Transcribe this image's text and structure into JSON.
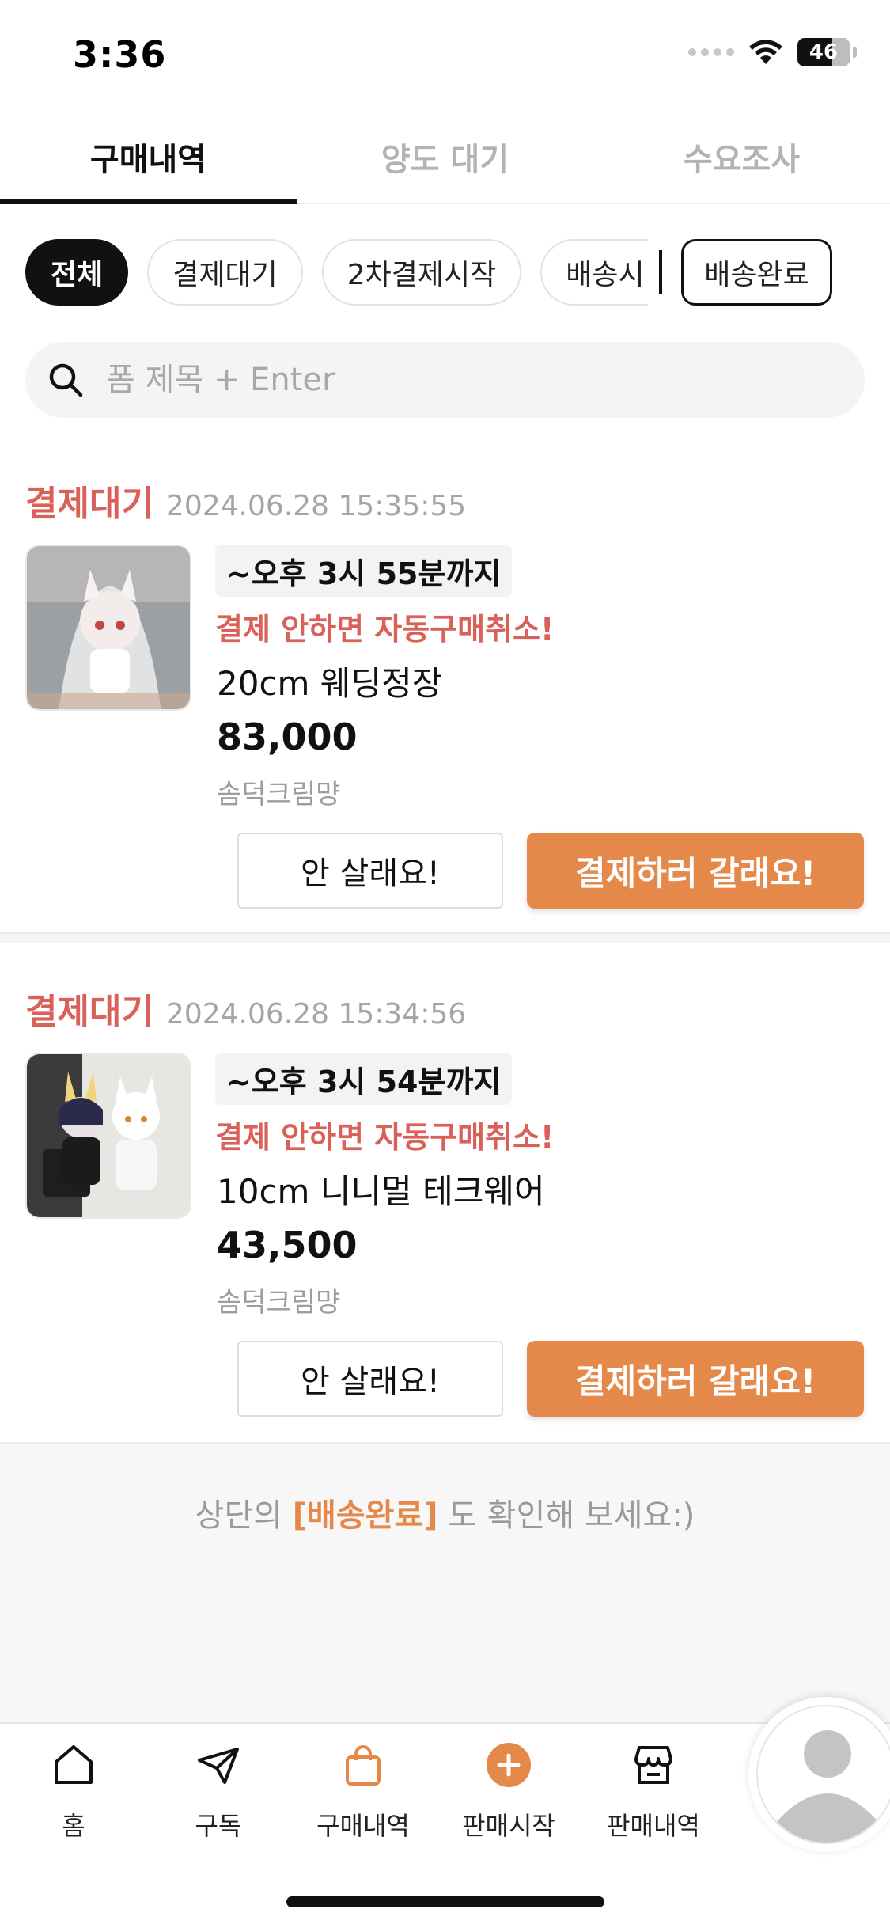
{
  "status_bar": {
    "time": "3:36",
    "battery": "46"
  },
  "top_tabs": [
    {
      "label": "구매내역",
      "active": true
    },
    {
      "label": "양도 대기",
      "active": false
    },
    {
      "label": "수요조사",
      "active": false
    }
  ],
  "chips": {
    "all": "전체",
    "pending_payment": "결제대기",
    "second_payment": "2차결제시작",
    "shipping": "배송시",
    "delivered": "배송완료"
  },
  "search": {
    "placeholder": "폼 제목 + Enter"
  },
  "orders": [
    {
      "status": "결제대기",
      "date": "2024.06.28 15:35:55",
      "deadline": "~오후 3시 55분까지",
      "warning": "결제 안하면 자동구매취소!",
      "name": "20cm 웨딩정장",
      "price": "83,000",
      "seller": "솜덕크림먕",
      "cancel_label": "안 살래요!",
      "pay_label": "결제하러 갈래요!"
    },
    {
      "status": "결제대기",
      "date": "2024.06.28 15:34:56",
      "deadline": "~오후 3시 54분까지",
      "warning": "결제 안하면 자동구매취소!",
      "name": "10cm 니니멀 테크웨어",
      "price": "43,500",
      "seller": "솜덕크림먕",
      "cancel_label": "안 살래요!",
      "pay_label": "결제하러 갈래요!"
    }
  ],
  "footer_hint": {
    "prefix": "상단의 ",
    "highlight": "[배송완료]",
    "suffix": " 도 확인해 보세요:)"
  },
  "bottom_nav": {
    "home": "홈",
    "subscribe": "구독",
    "purchases": "구매내역",
    "start_selling": "판매시작",
    "sales": "판매내역"
  },
  "colors": {
    "accent": "#e5894a",
    "status_red": "#d9615a"
  }
}
